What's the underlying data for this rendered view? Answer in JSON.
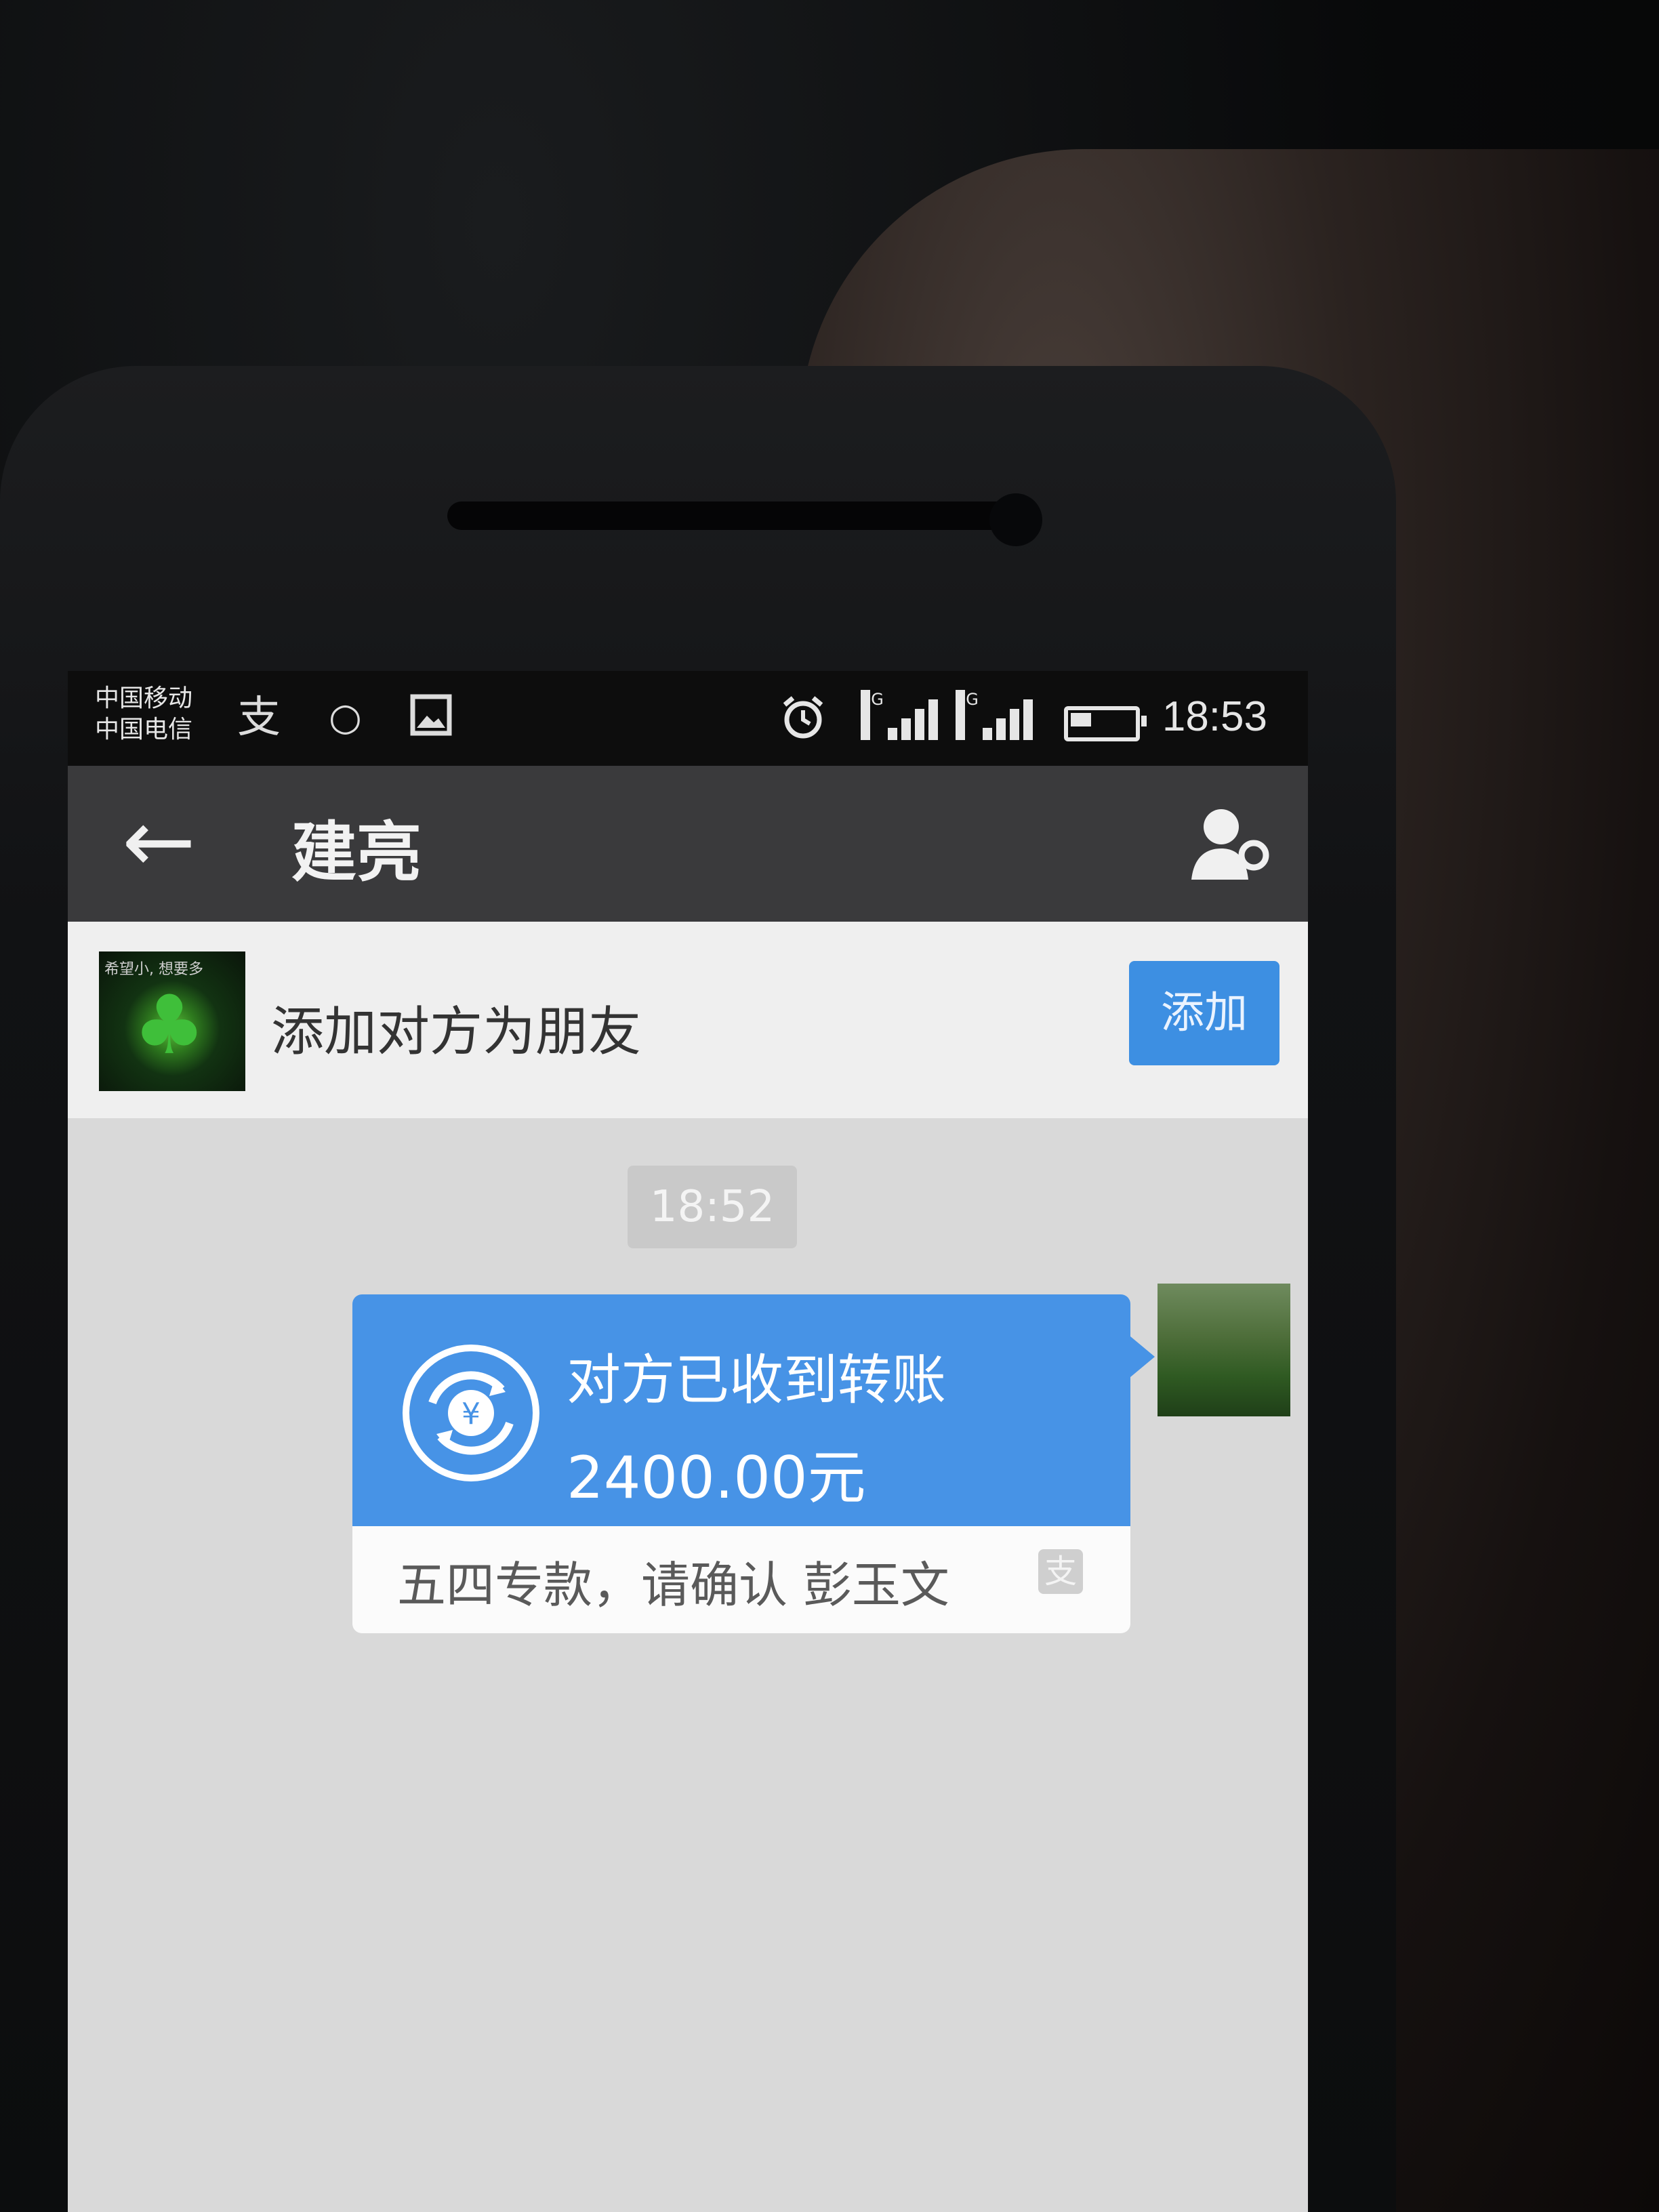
{
  "status_bar": {
    "carrier_1": "中国移动",
    "carrier_2": "中国电信",
    "time": "18:53",
    "signal_1_label": "3G",
    "signal_2_label": "3G"
  },
  "header": {
    "back_label": "←",
    "title": "建亮"
  },
  "add_friend": {
    "avatar_caption": "希望小, 想要多",
    "text": "添加对方为朋友",
    "button_label": "添加"
  },
  "chat": {
    "timestamp": "18:52",
    "transfer": {
      "status": "对方已收到转账",
      "amount": "2400.00元",
      "note": "五四专款，请确认 彭玉文"
    }
  },
  "colors": {
    "accent_blue": "#4793e6",
    "titlebar": "#3a3a3c",
    "chat_bg": "#d9d9d9"
  }
}
